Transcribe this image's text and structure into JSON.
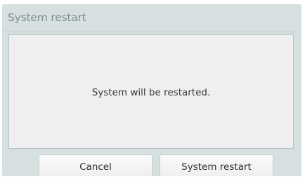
{
  "dialog": {
    "title": "System restart",
    "message": "System will be restarted."
  },
  "buttons": {
    "cancel_label": "Cancel",
    "confirm_label": "System restart"
  }
}
